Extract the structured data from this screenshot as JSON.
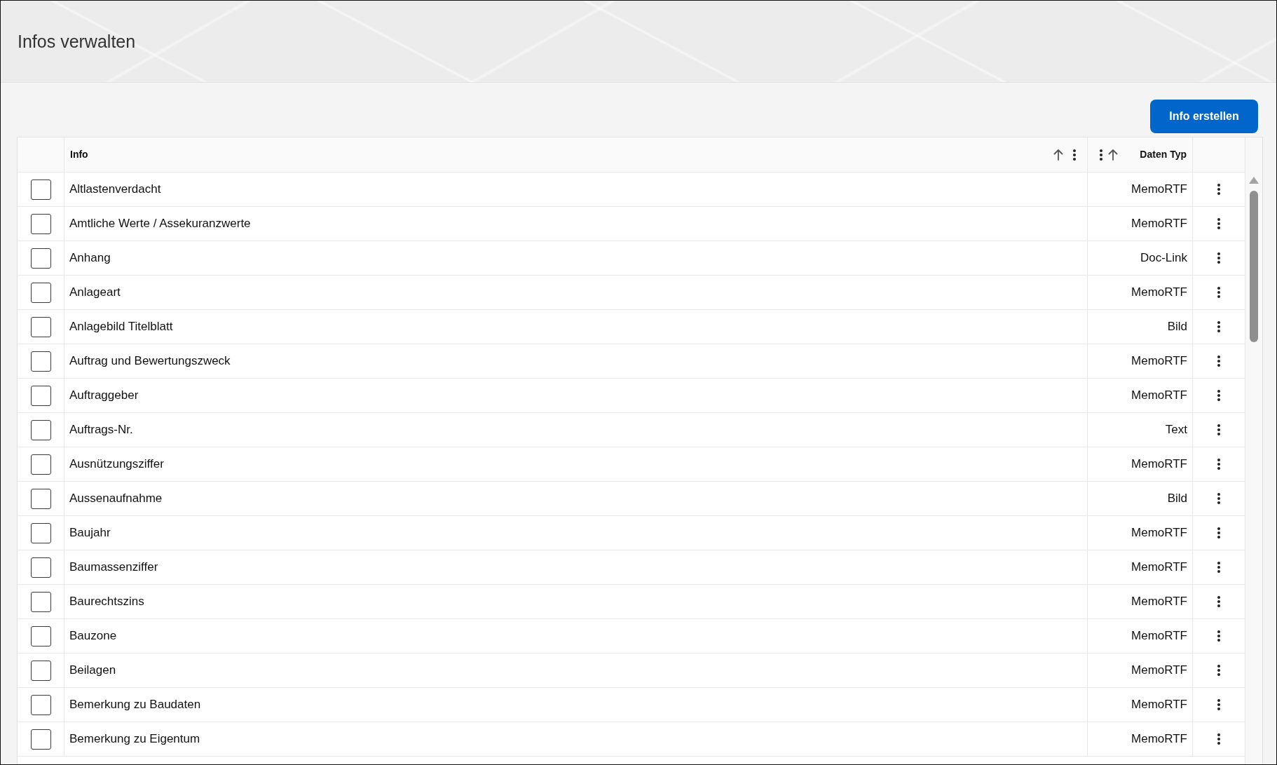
{
  "page": {
    "title": "Infos verwalten"
  },
  "toolbar": {
    "create_button": "Info erstellen"
  },
  "table": {
    "columns": [
      {
        "label": "Info"
      },
      {
        "label": "Daten Typ"
      }
    ],
    "rows": [
      {
        "checked": false,
        "info": "Altlastenverdacht",
        "data_type": "MemoRTF"
      },
      {
        "checked": false,
        "info": "Amtliche Werte / Assekuranzwerte",
        "data_type": "MemoRTF"
      },
      {
        "checked": false,
        "info": "Anhang",
        "data_type": "Doc-Link"
      },
      {
        "checked": false,
        "info": "Anlageart",
        "data_type": "MemoRTF"
      },
      {
        "checked": false,
        "info": "Anlagebild Titelblatt",
        "data_type": "Bild"
      },
      {
        "checked": false,
        "info": "Auftrag und Bewertungszweck",
        "data_type": "MemoRTF"
      },
      {
        "checked": false,
        "info": "Auftraggeber",
        "data_type": "MemoRTF"
      },
      {
        "checked": false,
        "info": "Auftrags-Nr.",
        "data_type": "Text"
      },
      {
        "checked": false,
        "info": "Ausnützungsziffer",
        "data_type": "MemoRTF"
      },
      {
        "checked": false,
        "info": "Aussenaufnahme",
        "data_type": "Bild"
      },
      {
        "checked": false,
        "info": "Baujahr",
        "data_type": "MemoRTF"
      },
      {
        "checked": false,
        "info": "Baumassenziffer",
        "data_type": "MemoRTF"
      },
      {
        "checked": false,
        "info": "Baurechtszins",
        "data_type": "MemoRTF"
      },
      {
        "checked": false,
        "info": "Bauzone",
        "data_type": "MemoRTF"
      },
      {
        "checked": false,
        "info": "Beilagen",
        "data_type": "MemoRTF"
      },
      {
        "checked": false,
        "info": "Bemerkung zu Baudaten",
        "data_type": "MemoRTF"
      },
      {
        "checked": false,
        "info": "Bemerkung zu Eigentum",
        "data_type": "MemoRTF"
      }
    ]
  }
}
